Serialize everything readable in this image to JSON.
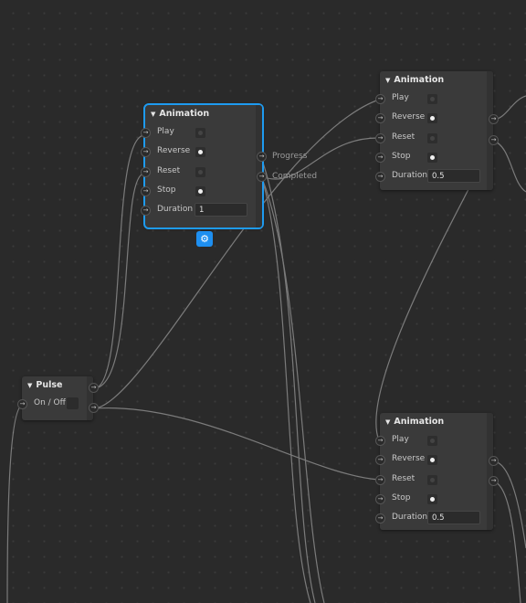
{
  "colors": {
    "background": "#2a2a2a",
    "node": "#3a3a3a",
    "selection": "#1e9bf0",
    "wire": "#8a8a8a"
  },
  "nodes": {
    "anim_selected": {
      "title": "Animation",
      "inputs": [
        {
          "label": "Play",
          "on": false
        },
        {
          "label": "Reverse",
          "on": true
        },
        {
          "label": "Reset",
          "on": false
        },
        {
          "label": "Stop",
          "on": true
        }
      ],
      "duration_label": "Duration",
      "duration_value": "1",
      "outputs": [
        "Progress",
        "Completed"
      ],
      "settings_icon": "gear-icon"
    },
    "anim_top": {
      "title": "Animation",
      "inputs": [
        {
          "label": "Play",
          "on": false
        },
        {
          "label": "Reverse",
          "on": true
        },
        {
          "label": "Reset",
          "on": false
        },
        {
          "label": "Stop",
          "on": true
        }
      ],
      "duration_label": "Duration",
      "duration_value": "0.5"
    },
    "anim_bottom": {
      "title": "Animation",
      "inputs": [
        {
          "label": "Play",
          "on": false
        },
        {
          "label": "Reverse",
          "on": true
        },
        {
          "label": "Reset",
          "on": false
        },
        {
          "label": "Stop",
          "on": true
        }
      ],
      "duration_label": "Duration",
      "duration_value": "0.5"
    },
    "pulse": {
      "title": "Pulse",
      "input_label": "On / Off"
    }
  }
}
